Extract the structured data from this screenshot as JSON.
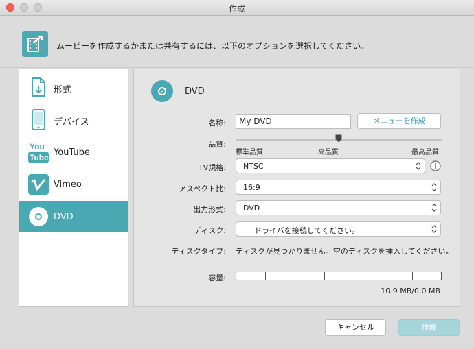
{
  "window": {
    "title": "作成"
  },
  "header": {
    "text": "ムービーを作成するかまたは共有するには、以下のオプションを選択してください。",
    "icon": "film-share-icon"
  },
  "sidebar": {
    "items": [
      {
        "label": "形式",
        "icon": "file-download-icon",
        "active": false
      },
      {
        "label": "デバイス",
        "icon": "phone-icon",
        "active": false
      },
      {
        "label": "YouTube",
        "icon": "youtube-icon",
        "active": false
      },
      {
        "label": "Vimeo",
        "icon": "vimeo-icon",
        "active": false
      },
      {
        "label": "DVD",
        "icon": "disc-icon",
        "active": true
      }
    ]
  },
  "panel": {
    "title": "DVD",
    "name_label": "名称:",
    "name_value": "My DVD",
    "menu_button": "メニューを作成",
    "quality_label": "品質:",
    "quality_options": {
      "low": "標準品質",
      "mid": "高品質",
      "high": "最高品質"
    },
    "quality_level": 0.5,
    "tv_label": "TV規格:",
    "tv_value": "NTSC",
    "aspect_label": "アスペクト比:",
    "aspect_value": "16:9",
    "output_label": "出力形式:",
    "output_value": "DVD",
    "disc_label": "ディスク:",
    "disc_value": "ドライバを接続してください。",
    "disc_type_label": "ディスクタイプ:",
    "disc_type_value": "ディスクが見つかりません。空のディスクを挿入してください。",
    "capacity_label": "容量:",
    "capacity_value": "10.9 MB/0.0 MB"
  },
  "footer": {
    "cancel": "キャンセル",
    "create": "作成"
  },
  "colors": {
    "accent": "#49a8b2",
    "link": "#3a97b8"
  }
}
